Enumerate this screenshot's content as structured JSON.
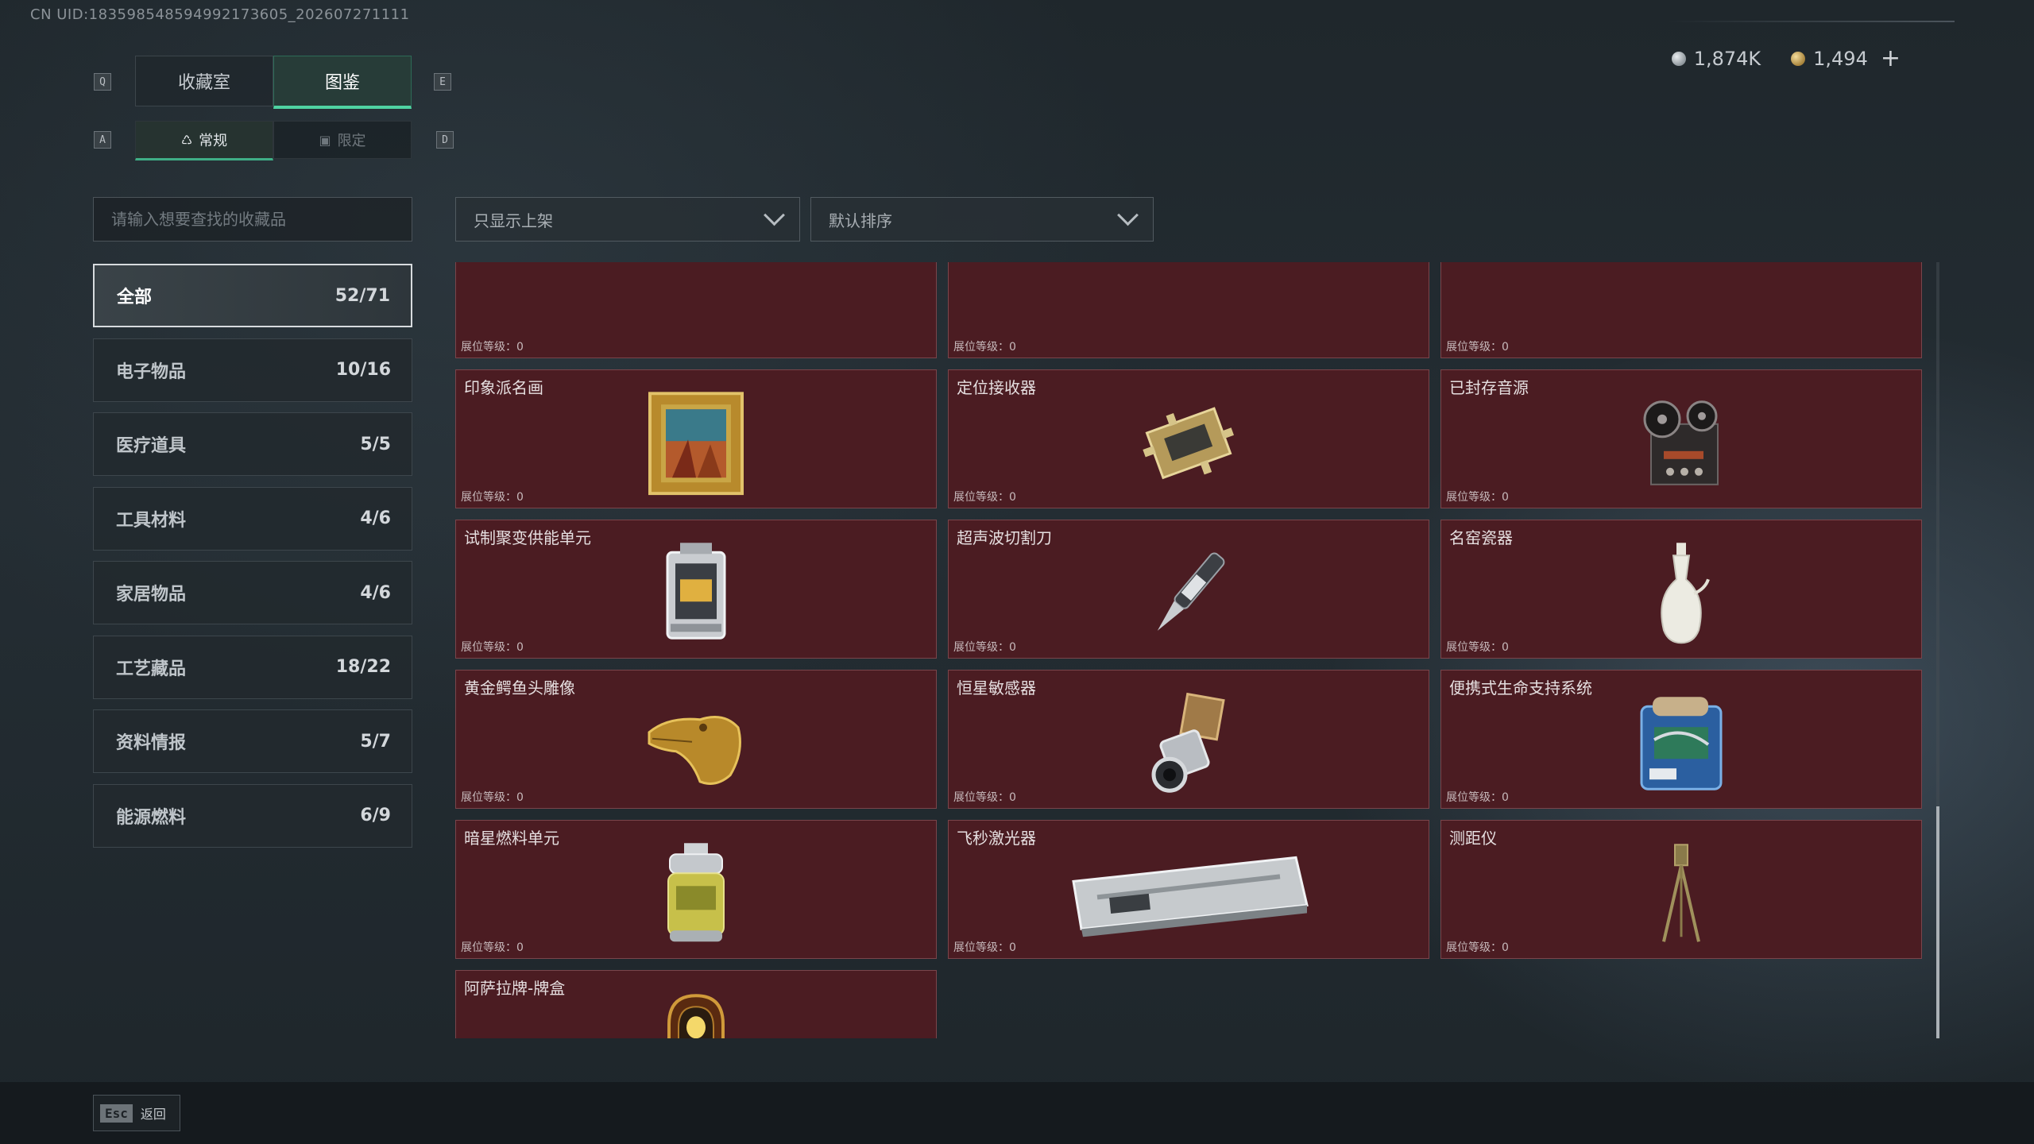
{
  "uid_text": "CN UID:183598548594992173605_202607271111",
  "currency": {
    "silver": "1,874K",
    "gold": "1,494",
    "plus": "+"
  },
  "keys": {
    "q": "Q",
    "e": "E",
    "a": "A",
    "d": "D"
  },
  "tabs": [
    "收藏室",
    "图鉴"
  ],
  "subtabs": [
    "常规",
    "限定"
  ],
  "search_placeholder": "请输入想要查找的收藏品",
  "filters": {
    "shelf": "只显示上架",
    "sort": "默认排序"
  },
  "categories": [
    {
      "name": "全部",
      "count": "52/71"
    },
    {
      "name": "电子物品",
      "count": "10/16"
    },
    {
      "name": "医疗道具",
      "count": "5/5"
    },
    {
      "name": "工具材料",
      "count": "4/6"
    },
    {
      "name": "家居物品",
      "count": "4/6"
    },
    {
      "name": "工艺藏品",
      "count": "18/22"
    },
    {
      "name": "资料情报",
      "count": "5/7"
    },
    {
      "name": "能源燃料",
      "count": "6/9"
    }
  ],
  "level_label": "展位等级：0",
  "items": [
    {
      "name": "",
      "icon": "unknown"
    },
    {
      "name": "",
      "icon": "unknown"
    },
    {
      "name": "",
      "icon": "unknown"
    },
    {
      "name": "印象派名画",
      "icon": "framed-painting-icon"
    },
    {
      "name": "定位接收器",
      "icon": "receiver-device-icon"
    },
    {
      "name": "已封存音源",
      "icon": "reel-recorder-icon"
    },
    {
      "name": "试制聚变供能单元",
      "icon": "fusion-cell-icon"
    },
    {
      "name": "超声波切割刀",
      "icon": "ultrasonic-knife-icon"
    },
    {
      "name": "名窑瓷器",
      "icon": "porcelain-vase-icon"
    },
    {
      "name": "黄金鳄鱼头雕像",
      "icon": "gold-crocodile-icon"
    },
    {
      "name": "恒星敏感器",
      "icon": "star-sensor-icon"
    },
    {
      "name": "便携式生命支持系统",
      "icon": "life-support-icon"
    },
    {
      "name": "暗星燃料单元",
      "icon": "fuel-canister-icon"
    },
    {
      "name": "飞秒激光器",
      "icon": "laser-case-icon"
    },
    {
      "name": "测距仪",
      "icon": "tripod-rangefinder-icon"
    },
    {
      "name": "阿萨拉牌-牌盒",
      "icon": "card-box-icon"
    }
  ],
  "back": {
    "key": "Esc",
    "label": "返回"
  }
}
